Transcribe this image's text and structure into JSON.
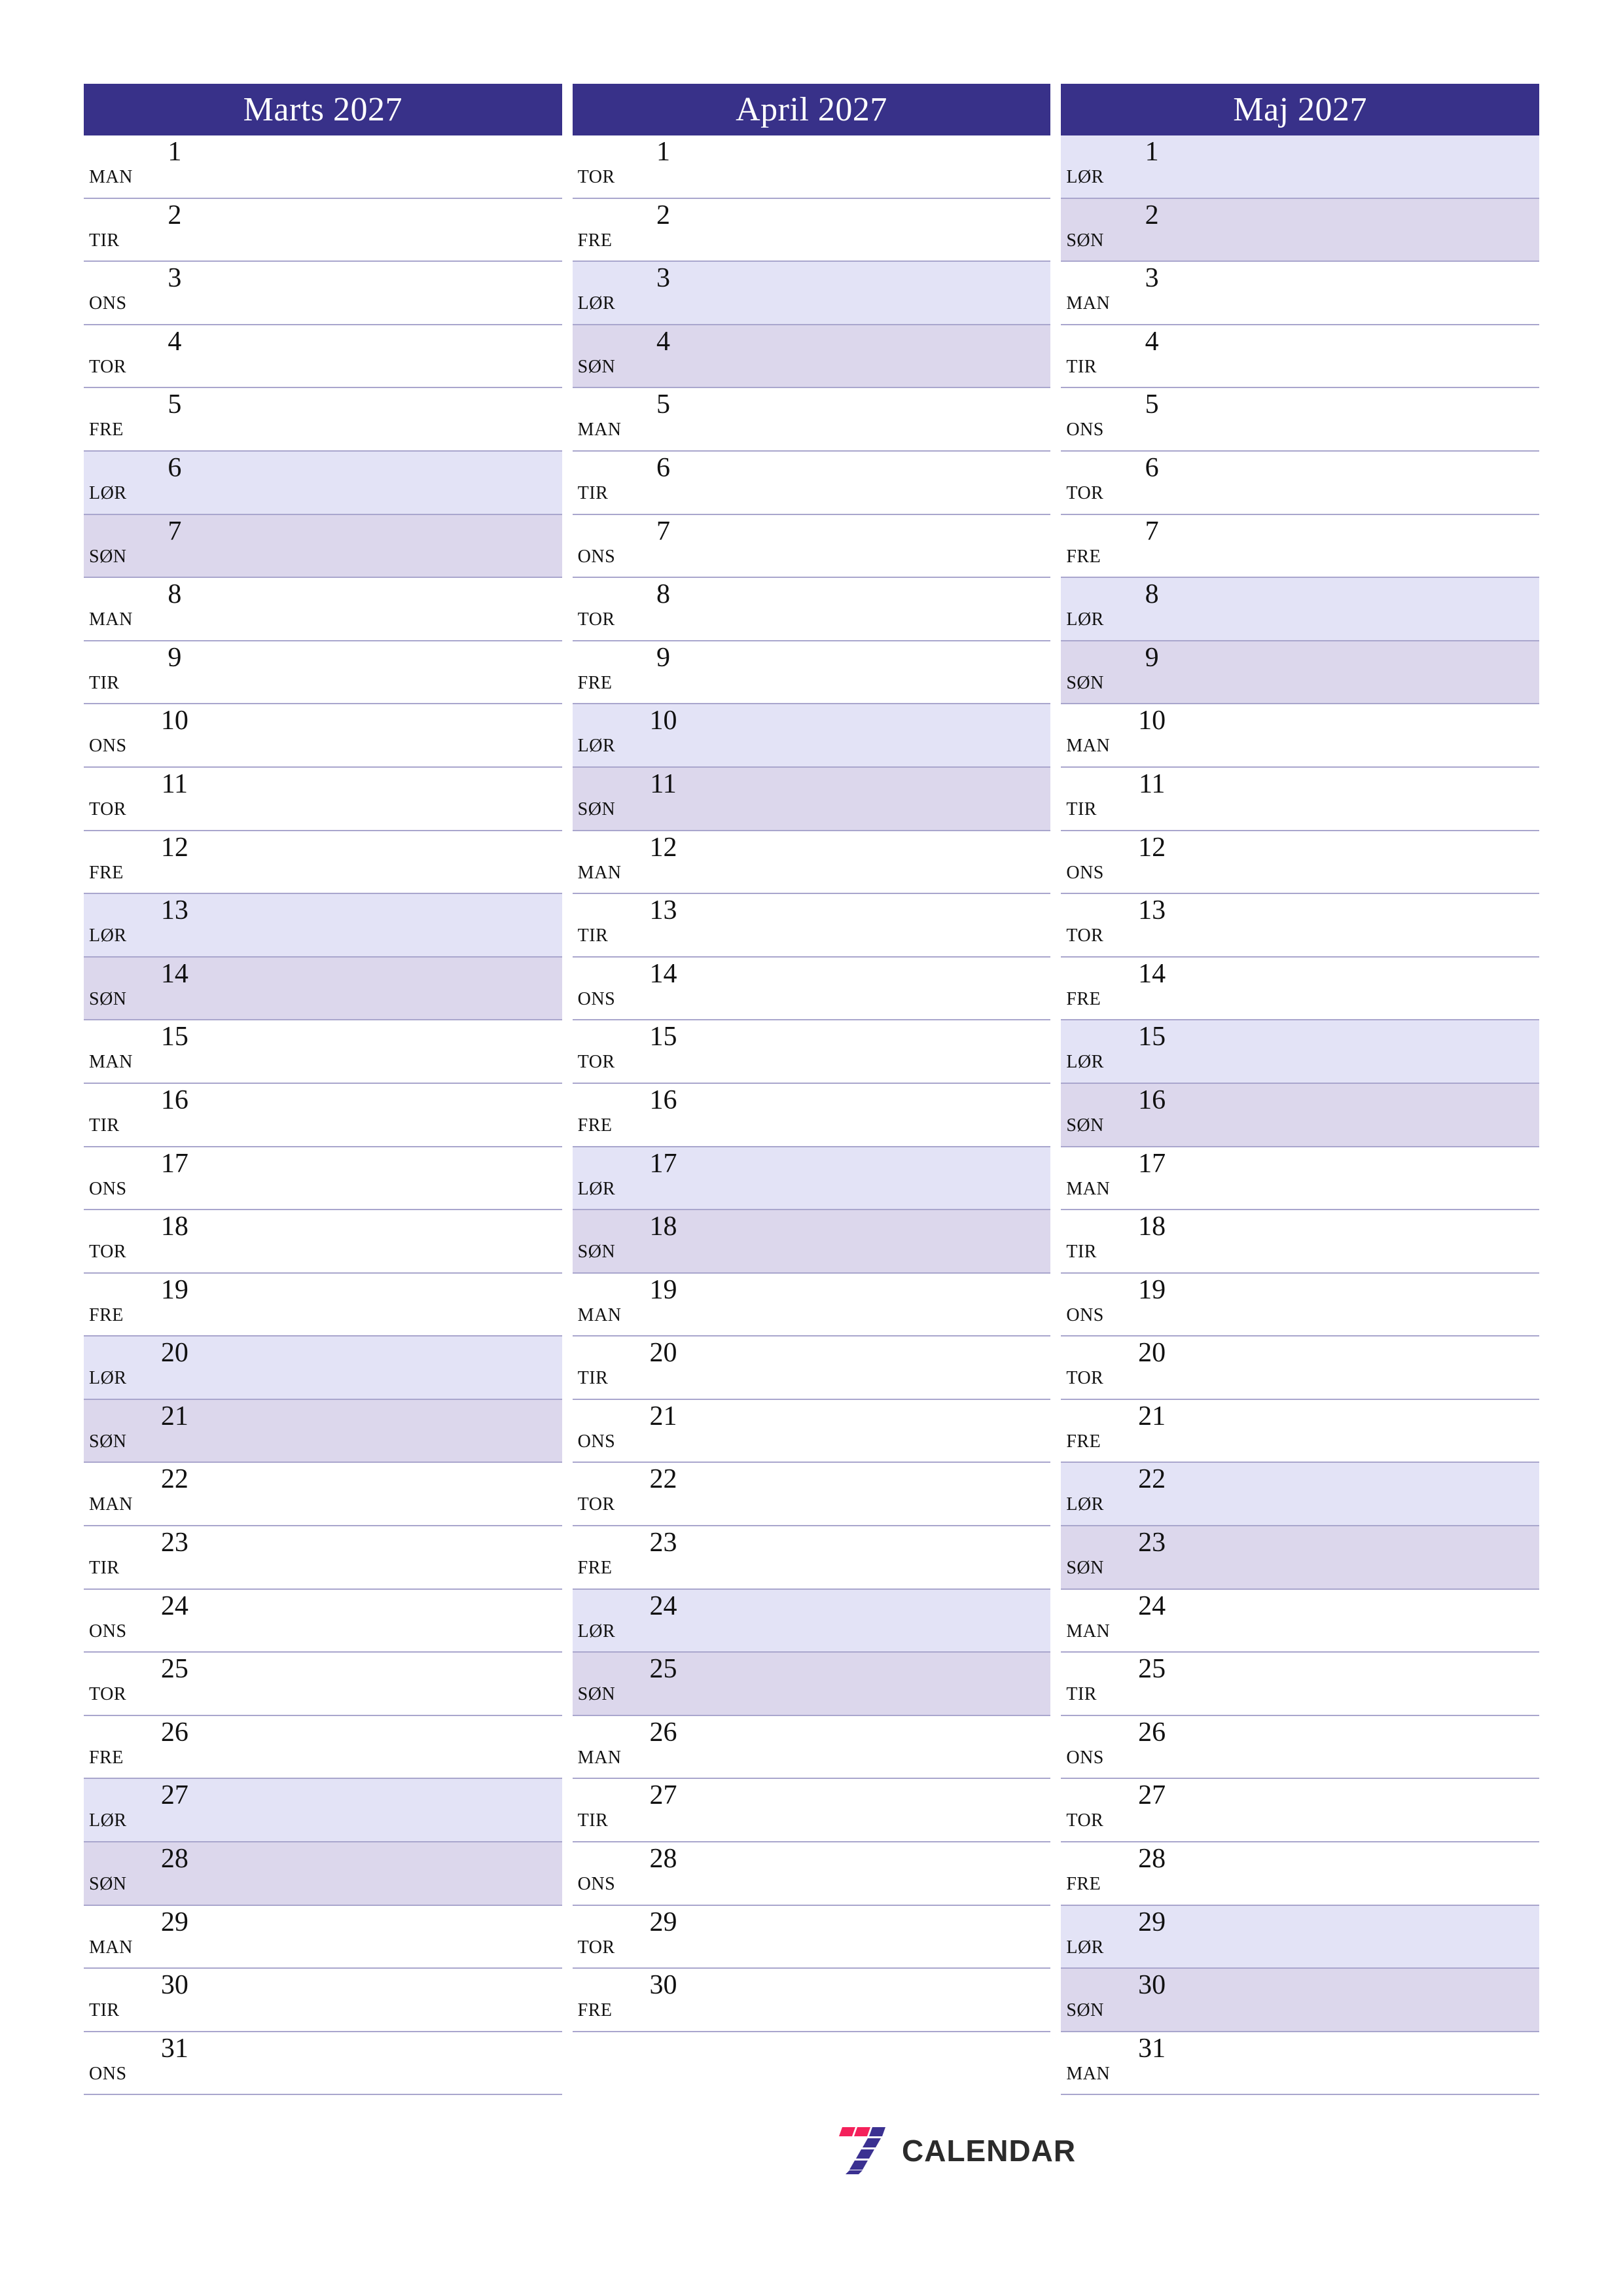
{
  "document": {
    "type": "printable-calendar-planner",
    "year": "2027",
    "language": "Danish",
    "colors": {
      "header_band": "#383189",
      "header_text": "#ffffff",
      "saturday_fill": "#e3e3f6",
      "sunday_fill": "#dcd7ec",
      "row_divider": "#a9a6cd",
      "page_background": "#ffffff",
      "logo_red": "#f4215b",
      "logo_purple": "#3b3191",
      "logo_text": "#2b2b2b"
    }
  },
  "footer": {
    "logo": {
      "mark_name": "seven-stripes-logo",
      "wordmark": "CALENDAR"
    }
  },
  "months": [
    {
      "name": "marts",
      "title": "Marts 2027",
      "days": [
        {
          "num": "1",
          "wd": "MAN",
          "kind": "weekday"
        },
        {
          "num": "2",
          "wd": "TIR",
          "kind": "weekday"
        },
        {
          "num": "3",
          "wd": "ONS",
          "kind": "weekday"
        },
        {
          "num": "4",
          "wd": "TOR",
          "kind": "weekday"
        },
        {
          "num": "5",
          "wd": "FRE",
          "kind": "weekday"
        },
        {
          "num": "6",
          "wd": "LØR",
          "kind": "sat"
        },
        {
          "num": "7",
          "wd": "SØN",
          "kind": "sun"
        },
        {
          "num": "8",
          "wd": "MAN",
          "kind": "weekday"
        },
        {
          "num": "9",
          "wd": "TIR",
          "kind": "weekday"
        },
        {
          "num": "10",
          "wd": "ONS",
          "kind": "weekday"
        },
        {
          "num": "11",
          "wd": "TOR",
          "kind": "weekday"
        },
        {
          "num": "12",
          "wd": "FRE",
          "kind": "weekday"
        },
        {
          "num": "13",
          "wd": "LØR",
          "kind": "sat"
        },
        {
          "num": "14",
          "wd": "SØN",
          "kind": "sun"
        },
        {
          "num": "15",
          "wd": "MAN",
          "kind": "weekday"
        },
        {
          "num": "16",
          "wd": "TIR",
          "kind": "weekday"
        },
        {
          "num": "17",
          "wd": "ONS",
          "kind": "weekday"
        },
        {
          "num": "18",
          "wd": "TOR",
          "kind": "weekday"
        },
        {
          "num": "19",
          "wd": "FRE",
          "kind": "weekday"
        },
        {
          "num": "20",
          "wd": "LØR",
          "kind": "sat"
        },
        {
          "num": "21",
          "wd": "SØN",
          "kind": "sun"
        },
        {
          "num": "22",
          "wd": "MAN",
          "kind": "weekday"
        },
        {
          "num": "23",
          "wd": "TIR",
          "kind": "weekday"
        },
        {
          "num": "24",
          "wd": "ONS",
          "kind": "weekday"
        },
        {
          "num": "25",
          "wd": "TOR",
          "kind": "weekday"
        },
        {
          "num": "26",
          "wd": "FRE",
          "kind": "weekday"
        },
        {
          "num": "27",
          "wd": "LØR",
          "kind": "sat"
        },
        {
          "num": "28",
          "wd": "SØN",
          "kind": "sun"
        },
        {
          "num": "29",
          "wd": "MAN",
          "kind": "weekday"
        },
        {
          "num": "30",
          "wd": "TIR",
          "kind": "weekday"
        },
        {
          "num": "31",
          "wd": "ONS",
          "kind": "weekday"
        }
      ]
    },
    {
      "name": "april",
      "title": "April 2027",
      "days": [
        {
          "num": "1",
          "wd": "TOR",
          "kind": "weekday"
        },
        {
          "num": "2",
          "wd": "FRE",
          "kind": "weekday"
        },
        {
          "num": "3",
          "wd": "LØR",
          "kind": "sat"
        },
        {
          "num": "4",
          "wd": "SØN",
          "kind": "sun"
        },
        {
          "num": "5",
          "wd": "MAN",
          "kind": "weekday"
        },
        {
          "num": "6",
          "wd": "TIR",
          "kind": "weekday"
        },
        {
          "num": "7",
          "wd": "ONS",
          "kind": "weekday"
        },
        {
          "num": "8",
          "wd": "TOR",
          "kind": "weekday"
        },
        {
          "num": "9",
          "wd": "FRE",
          "kind": "weekday"
        },
        {
          "num": "10",
          "wd": "LØR",
          "kind": "sat"
        },
        {
          "num": "11",
          "wd": "SØN",
          "kind": "sun"
        },
        {
          "num": "12",
          "wd": "MAN",
          "kind": "weekday"
        },
        {
          "num": "13",
          "wd": "TIR",
          "kind": "weekday"
        },
        {
          "num": "14",
          "wd": "ONS",
          "kind": "weekday"
        },
        {
          "num": "15",
          "wd": "TOR",
          "kind": "weekday"
        },
        {
          "num": "16",
          "wd": "FRE",
          "kind": "weekday"
        },
        {
          "num": "17",
          "wd": "LØR",
          "kind": "sat"
        },
        {
          "num": "18",
          "wd": "SØN",
          "kind": "sun"
        },
        {
          "num": "19",
          "wd": "MAN",
          "kind": "weekday"
        },
        {
          "num": "20",
          "wd": "TIR",
          "kind": "weekday"
        },
        {
          "num": "21",
          "wd": "ONS",
          "kind": "weekday"
        },
        {
          "num": "22",
          "wd": "TOR",
          "kind": "weekday"
        },
        {
          "num": "23",
          "wd": "FRE",
          "kind": "weekday"
        },
        {
          "num": "24",
          "wd": "LØR",
          "kind": "sat"
        },
        {
          "num": "25",
          "wd": "SØN",
          "kind": "sun"
        },
        {
          "num": "26",
          "wd": "MAN",
          "kind": "weekday"
        },
        {
          "num": "27",
          "wd": "TIR",
          "kind": "weekday"
        },
        {
          "num": "28",
          "wd": "ONS",
          "kind": "weekday"
        },
        {
          "num": "29",
          "wd": "TOR",
          "kind": "weekday"
        },
        {
          "num": "30",
          "wd": "FRE",
          "kind": "weekday"
        }
      ]
    },
    {
      "name": "maj",
      "title": "Maj 2027",
      "days": [
        {
          "num": "1",
          "wd": "LØR",
          "kind": "sat"
        },
        {
          "num": "2",
          "wd": "SØN",
          "kind": "sun"
        },
        {
          "num": "3",
          "wd": "MAN",
          "kind": "weekday"
        },
        {
          "num": "4",
          "wd": "TIR",
          "kind": "weekday"
        },
        {
          "num": "5",
          "wd": "ONS",
          "kind": "weekday"
        },
        {
          "num": "6",
          "wd": "TOR",
          "kind": "weekday"
        },
        {
          "num": "7",
          "wd": "FRE",
          "kind": "weekday"
        },
        {
          "num": "8",
          "wd": "LØR",
          "kind": "sat"
        },
        {
          "num": "9",
          "wd": "SØN",
          "kind": "sun"
        },
        {
          "num": "10",
          "wd": "MAN",
          "kind": "weekday"
        },
        {
          "num": "11",
          "wd": "TIR",
          "kind": "weekday"
        },
        {
          "num": "12",
          "wd": "ONS",
          "kind": "weekday"
        },
        {
          "num": "13",
          "wd": "TOR",
          "kind": "weekday"
        },
        {
          "num": "14",
          "wd": "FRE",
          "kind": "weekday"
        },
        {
          "num": "15",
          "wd": "LØR",
          "kind": "sat"
        },
        {
          "num": "16",
          "wd": "SØN",
          "kind": "sun"
        },
        {
          "num": "17",
          "wd": "MAN",
          "kind": "weekday"
        },
        {
          "num": "18",
          "wd": "TIR",
          "kind": "weekday"
        },
        {
          "num": "19",
          "wd": "ONS",
          "kind": "weekday"
        },
        {
          "num": "20",
          "wd": "TOR",
          "kind": "weekday"
        },
        {
          "num": "21",
          "wd": "FRE",
          "kind": "weekday"
        },
        {
          "num": "22",
          "wd": "LØR",
          "kind": "sat"
        },
        {
          "num": "23",
          "wd": "SØN",
          "kind": "sun"
        },
        {
          "num": "24",
          "wd": "MAN",
          "kind": "weekday"
        },
        {
          "num": "25",
          "wd": "TIR",
          "kind": "weekday"
        },
        {
          "num": "26",
          "wd": "ONS",
          "kind": "weekday"
        },
        {
          "num": "27",
          "wd": "TOR",
          "kind": "weekday"
        },
        {
          "num": "28",
          "wd": "FRE",
          "kind": "weekday"
        },
        {
          "num": "29",
          "wd": "LØR",
          "kind": "sat"
        },
        {
          "num": "30",
          "wd": "SØN",
          "kind": "sun"
        },
        {
          "num": "31",
          "wd": "MAN",
          "kind": "weekday"
        }
      ]
    }
  ]
}
